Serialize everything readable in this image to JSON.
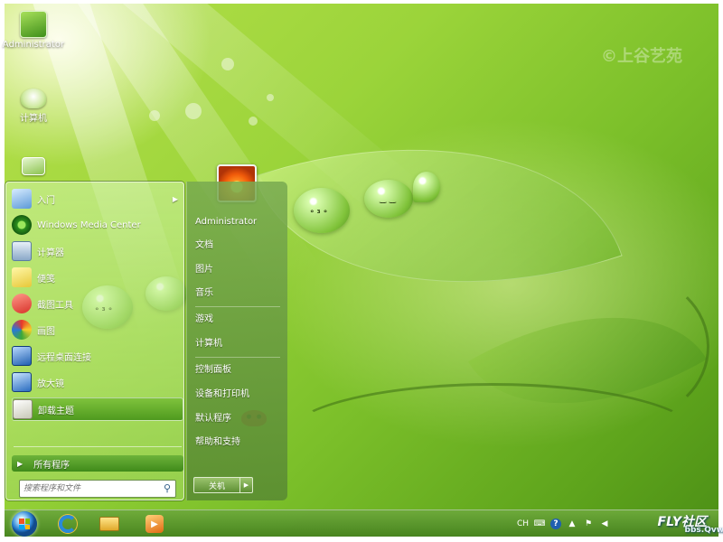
{
  "desktop": {
    "icons": [
      {
        "label": "Administrator",
        "icon": "user-folder-icon"
      },
      {
        "label": "计算机",
        "icon": "computer-icon"
      },
      {
        "label": "",
        "icon": "network-icon"
      }
    ],
    "watermark_top_right": "©上谷艺苑",
    "accent": "#7cc02a"
  },
  "start_menu": {
    "programs": [
      {
        "label": "入门",
        "icon": "getting-started-icon",
        "has_submenu": true
      },
      {
        "label": "Windows Media Center",
        "icon": "media-center-icon"
      },
      {
        "label": "计算器",
        "icon": "calculator-icon"
      },
      {
        "label": "便笺",
        "icon": "sticky-notes-icon"
      },
      {
        "label": "截图工具",
        "icon": "snipping-tool-icon"
      },
      {
        "label": "画图",
        "icon": "paint-icon"
      },
      {
        "label": "远程桌面连接",
        "icon": "remote-desktop-icon"
      },
      {
        "label": "放大镜",
        "icon": "magnifier-icon"
      },
      {
        "label": "卸载主题",
        "icon": "uninstall-theme-icon",
        "selected": true
      }
    ],
    "all_programs": "所有程序",
    "search_placeholder": "搜索程序和文件",
    "right_items": [
      "Administrator",
      "文档",
      "图片",
      "音乐",
      "游戏",
      "计算机",
      "控制面板",
      "设备和打印机",
      "默认程序",
      "帮助和支持"
    ],
    "shutdown_label": "关机",
    "more_icon": "arrow-right-icon"
  },
  "taskbar": {
    "pinned": [
      {
        "icon": "internet-explorer-icon"
      },
      {
        "icon": "file-explorer-icon"
      },
      {
        "icon": "media-player-icon"
      }
    ],
    "tray": {
      "language": "CH",
      "icons": [
        "keyboard-icon",
        "help-icon",
        "show-hidden-icon",
        "action-center-icon",
        "volume-icon"
      ]
    }
  },
  "watermark": {
    "brand": "FLY社区",
    "url": "bbs.Qvw.cn"
  }
}
